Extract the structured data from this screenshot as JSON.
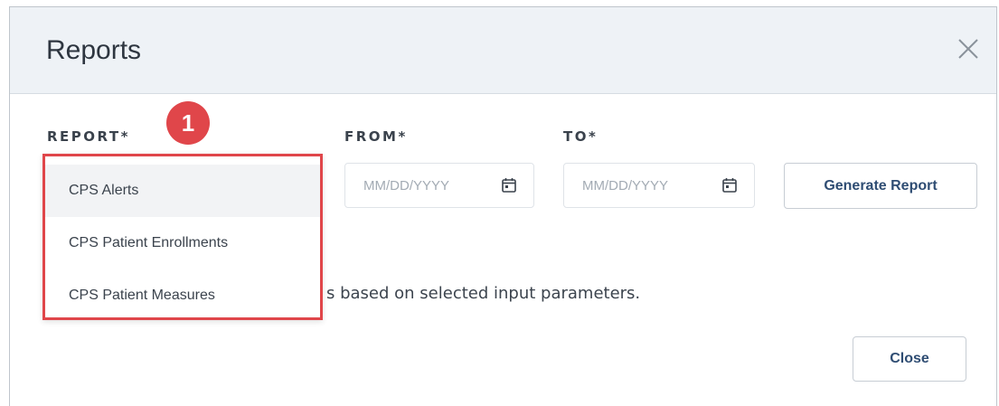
{
  "dialog": {
    "title": "Reports",
    "close_icon": "close-x-icon"
  },
  "form": {
    "report_label": "REPORT*",
    "from_label": "FROM*",
    "to_label": "TO*",
    "from_placeholder": "MM/DD/YYYY",
    "to_placeholder": "MM/DD/YYYY",
    "calendar_icon": "calendar-icon",
    "generate_button": "Generate Report"
  },
  "dropdown": {
    "options": [
      {
        "label": "CPS Alerts",
        "highlighted": true
      },
      {
        "label": "CPS Patient Enrollments",
        "highlighted": false
      },
      {
        "label": "CPS Patient Measures",
        "highlighted": false
      }
    ],
    "highlight_color": "#e0464a"
  },
  "info": {
    "text": "s based on selected input parameters."
  },
  "footer": {
    "close_button": "Close"
  },
  "annotation": {
    "step_number": "1",
    "color": "#e0464a"
  },
  "colors": {
    "header_bg": "#eef2f6",
    "button_text": "#2f4d73"
  }
}
